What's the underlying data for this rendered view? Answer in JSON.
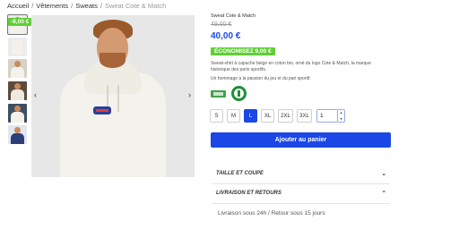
{
  "breadcrumb": {
    "items": [
      "Accueil",
      "Vêtements",
      "Sweats"
    ],
    "current": "Sweat Cote & Match",
    "separator": "/"
  },
  "gallery": {
    "discount_badge": "-9,00 €",
    "thumbnail_count": 6,
    "prev_arrow": "‹",
    "next_arrow": "›"
  },
  "product": {
    "title": "Sweat Cote & Match",
    "old_price": "49,00 €",
    "price": "40,00 €",
    "savings_label": "ÉCONOMISEZ 9,00 €",
    "description": "Sweat-shirt à capuche beige en coton bio, orné du logo Cote & Match, la marque historique des paris sportifs.",
    "tagline": "Un hommage à la passion du jeu et du pari sportif.",
    "cert_icons": [
      "organic-cotton-icon",
      "eco-label-icon"
    ]
  },
  "sizes": {
    "options": [
      "S",
      "M",
      "L",
      "XL",
      "2XL",
      "3XL"
    ],
    "selected": "L"
  },
  "quantity": {
    "value": "1",
    "up": "▲",
    "down": "▼"
  },
  "add_to_cart_label": "Ajouter au panier",
  "accordions": [
    {
      "title": "TAILLE ET COUPE",
      "chevron": "⌄"
    },
    {
      "title": "LIVRAISON ET RETOURS",
      "chevron": "⌃"
    }
  ],
  "delivery_text": "Livraison sous 24h / Retour sous 15 jours",
  "colors": {
    "accent": "#1b47e6",
    "promo": "#5fcf35"
  }
}
